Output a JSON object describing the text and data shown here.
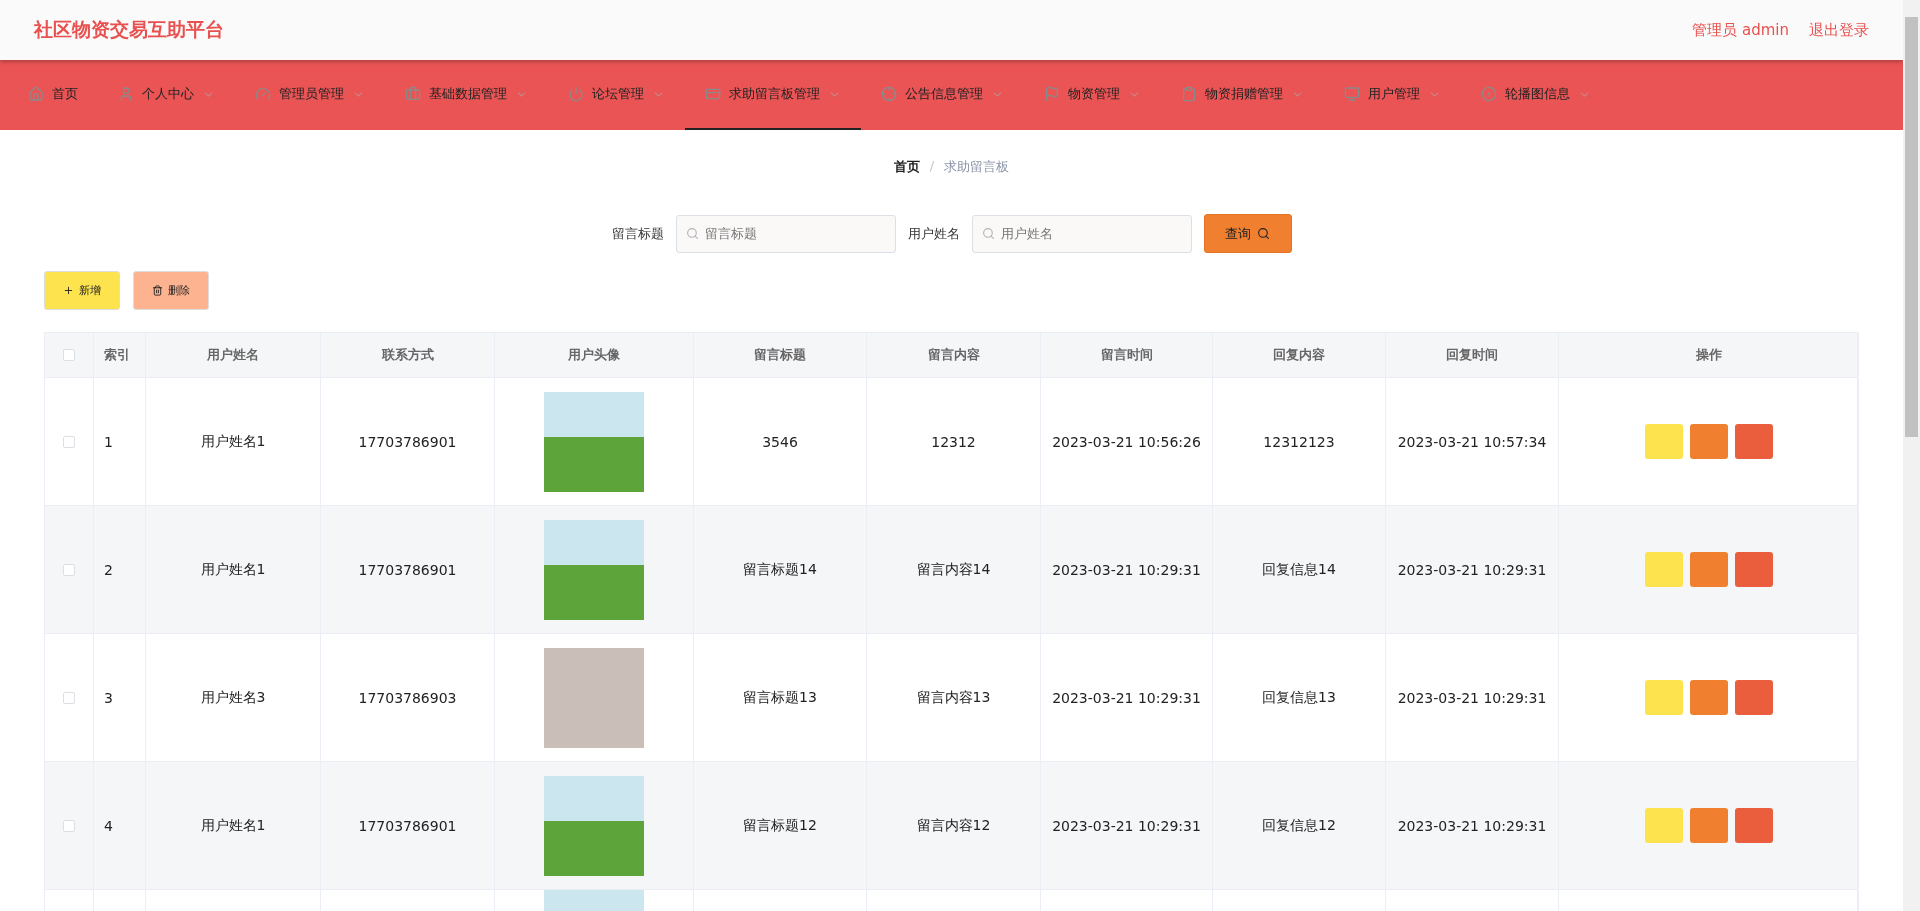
{
  "header": {
    "title": "社区物资交易互助平台",
    "user": "管理员 admin",
    "logout": "退出登录"
  },
  "nav": [
    {
      "label": "首页",
      "dropdown": false,
      "selected": false
    },
    {
      "label": "个人中心",
      "dropdown": true,
      "selected": false
    },
    {
      "label": "管理员管理",
      "dropdown": true,
      "selected": false
    },
    {
      "label": "基础数据管理",
      "dropdown": true,
      "selected": false
    },
    {
      "label": "论坛管理",
      "dropdown": true,
      "selected": false
    },
    {
      "label": "求助留言板管理",
      "dropdown": true,
      "selected": true
    },
    {
      "label": "公告信息管理",
      "dropdown": true,
      "selected": false
    },
    {
      "label": "物资管理",
      "dropdown": true,
      "selected": false
    },
    {
      "label": "物资捐赠管理",
      "dropdown": true,
      "selected": false
    },
    {
      "label": "用户管理",
      "dropdown": true,
      "selected": false
    },
    {
      "label": "轮播图信息",
      "dropdown": true,
      "selected": false
    }
  ],
  "breadcrumb": {
    "separator": "/",
    "items": [
      "首页",
      "求助留言板"
    ]
  },
  "search": {
    "fields": [
      {
        "label": "留言标题",
        "placeholder": "留言标题"
      },
      {
        "label": "用户姓名",
        "placeholder": "用户姓名"
      }
    ],
    "button": "查询"
  },
  "actions": [
    {
      "kind": "add",
      "label": "新增"
    },
    {
      "kind": "delete",
      "label": "删除"
    }
  ],
  "table": {
    "select_all_checked": false,
    "columns": [
      "索引",
      "用户姓名",
      "联系方式",
      "用户头像",
      "留言标题",
      "留言内容",
      "留言时间",
      "回复内容",
      "回复时间",
      "操作"
    ],
    "rows": [
      {
        "checked": false,
        "cells": [
          "1",
          "用户姓名1",
          "17703786901",
          {
            "kind": "cartoon"
          },
          "3546",
          "12312",
          "2023-03-21 10:56:26",
          "12312123",
          "2023-03-21 10:57:34"
        ]
      },
      {
        "checked": false,
        "cells": [
          "2",
          "用户姓名1",
          "17703786901",
          {
            "kind": "cartoon"
          },
          "留言标题14",
          "留言内容14",
          "2023-03-21 10:29:31",
          "回复信息14",
          "2023-03-21 10:29:31"
        ]
      },
      {
        "checked": false,
        "cells": [
          "3",
          "用户姓名3",
          "17703786903",
          {
            "kind": "photo"
          },
          "留言标题13",
          "留言内容13",
          "2023-03-21 10:29:31",
          "回复信息13",
          "2023-03-21 10:29:31"
        ]
      },
      {
        "checked": false,
        "cells": [
          "4",
          "用户姓名1",
          "17703786901",
          {
            "kind": "cartoon"
          },
          "留言标题12",
          "留言内容12",
          "2023-03-21 10:29:31",
          "回复信息12",
          "2023-03-21 10:29:31"
        ]
      },
      {
        "cells": [
          "",
          "",
          "",
          {
            "kind": "cartoon"
          }
        ]
      }
    ]
  }
}
